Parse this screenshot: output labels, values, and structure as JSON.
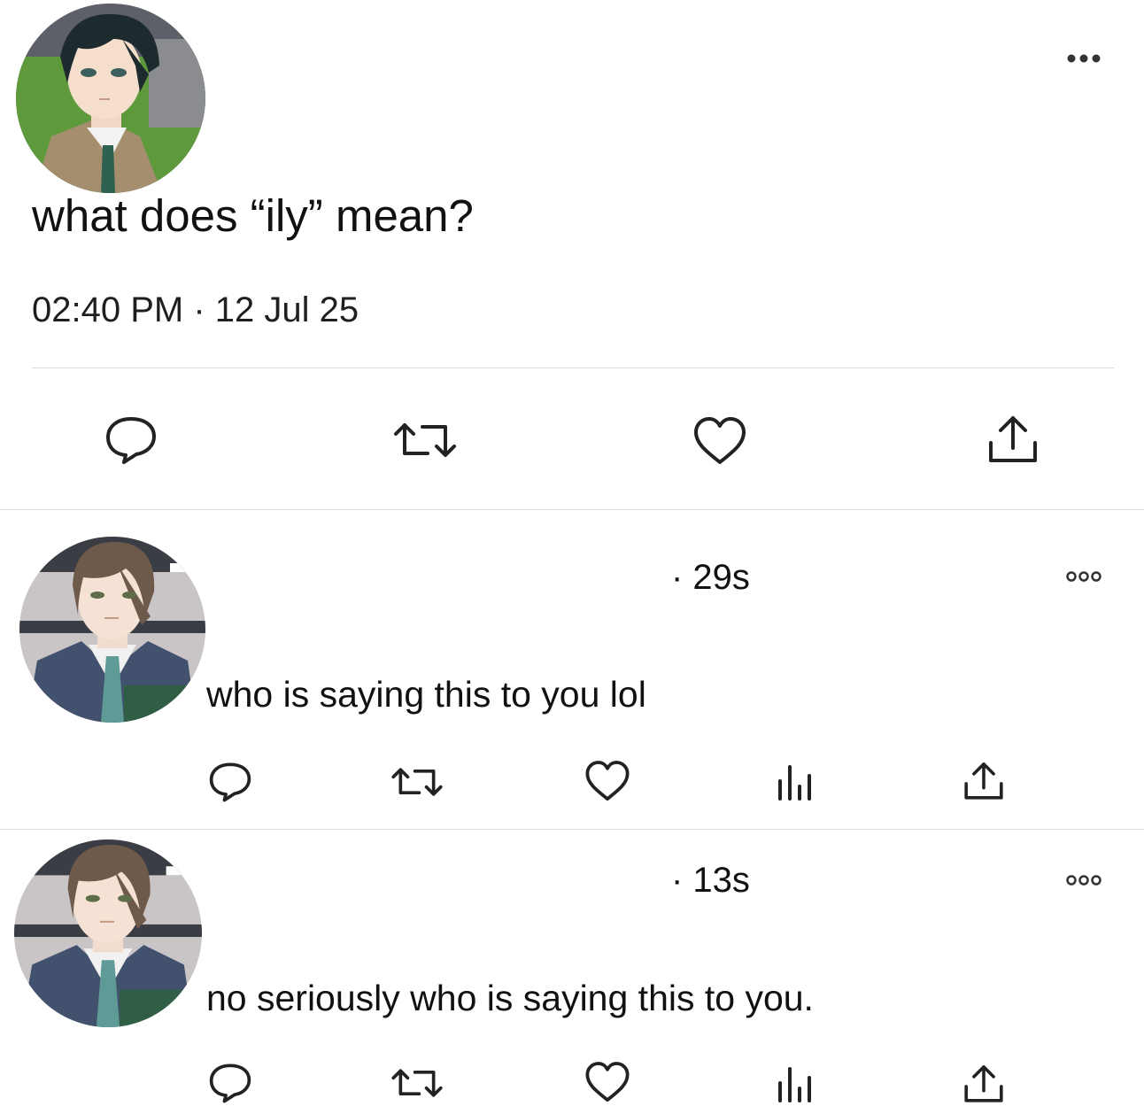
{
  "main_post": {
    "avatar_name": "author-avatar",
    "text": "what does “ily” mean?",
    "time": "02:40 PM",
    "separator": " · ",
    "date": "12 Jul 25",
    "actions": [
      "reply-icon",
      "repost-icon",
      "like-icon",
      "share-icon"
    ]
  },
  "replies": [
    {
      "time": "· 29s",
      "text": "who is saying this to you lol",
      "actions": [
        "reply-icon",
        "repost-icon",
        "like-icon",
        "views-icon",
        "share-icon"
      ]
    },
    {
      "time": "· 13s",
      "text": "no seriously who is saying this to you.",
      "actions": [
        "reply-icon",
        "repost-icon",
        "like-icon",
        "views-icon",
        "share-icon"
      ]
    }
  ],
  "colors": {
    "text": "#111111",
    "icon": "#222222",
    "divider": "#d9d9d9",
    "background": "#ffffff"
  }
}
